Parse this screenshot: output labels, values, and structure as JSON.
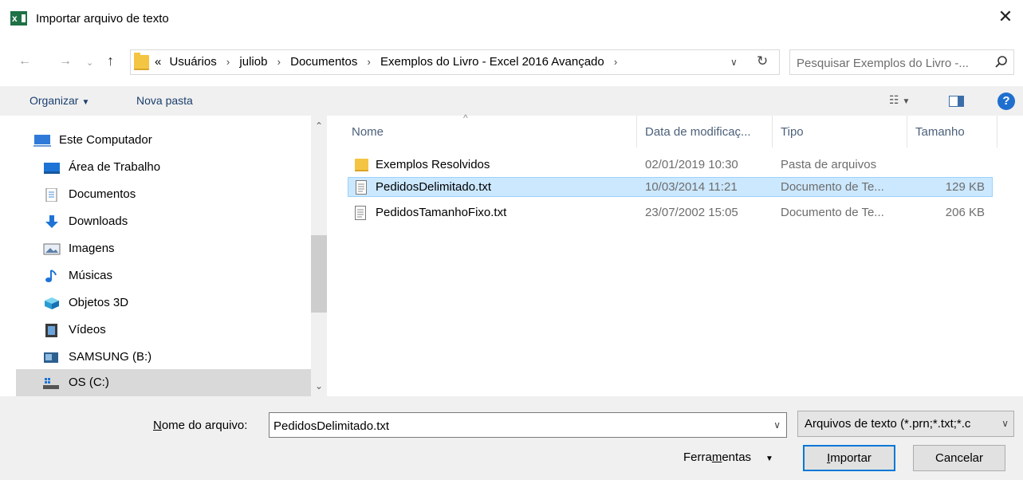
{
  "window": {
    "title": "Importar arquivo de texto",
    "app_icon": "excel-icon",
    "close_label": "✕"
  },
  "address": {
    "overflow": "«",
    "breadcrumbs": [
      "Usuários",
      "juliob",
      "Documentos",
      "Exemplos do Livro - Excel 2016 Avançado"
    ],
    "search_placeholder": "Pesquisar Exemplos do Livro -..."
  },
  "toolbar": {
    "organize_label": "Organizar",
    "new_folder_label": "Nova pasta"
  },
  "sidebar": {
    "items": [
      {
        "label": "Este Computador",
        "icon": "computer-icon"
      },
      {
        "label": "Área de Trabalho",
        "icon": "desktop-icon"
      },
      {
        "label": "Documentos",
        "icon": "documents-icon"
      },
      {
        "label": "Downloads",
        "icon": "downloads-icon"
      },
      {
        "label": "Imagens",
        "icon": "pictures-icon"
      },
      {
        "label": "Músicas",
        "icon": "music-icon"
      },
      {
        "label": "Objetos 3D",
        "icon": "3d-objects-icon"
      },
      {
        "label": "Vídeos",
        "icon": "videos-icon"
      },
      {
        "label": "SAMSUNG (B:)",
        "icon": "drive-icon"
      },
      {
        "label": "OS (C:)",
        "icon": "system-drive-icon",
        "selected": true
      }
    ]
  },
  "filelist": {
    "columns": [
      "Nome",
      "Data de modificaç...",
      "Tipo",
      "Tamanho"
    ],
    "rows": [
      {
        "name": "Exemplos Resolvidos",
        "date": "02/01/2019 10:30",
        "type": "Pasta de arquivos",
        "size": "",
        "icon": "folder-icon",
        "selected": false
      },
      {
        "name": "PedidosDelimitado.txt",
        "date": "10/03/2014 11:21",
        "type": "Documento de Te...",
        "size": "129 KB",
        "icon": "text-file-icon",
        "selected": true
      },
      {
        "name": "PedidosTamanhoFixo.txt",
        "date": "23/07/2002 15:05",
        "type": "Documento de Te...",
        "size": "206 KB",
        "icon": "text-file-icon",
        "selected": false
      }
    ]
  },
  "footer": {
    "filename_label_accel": "N",
    "filename_label_rest": "ome do arquivo:",
    "filename_value": "PedidosDelimitado.txt",
    "filetype_value": "Arquivos de texto (*.prn;*.txt;*.c",
    "tools_pre": "Ferra",
    "tools_accel": "m",
    "tools_post": "entas",
    "import_accel": "I",
    "import_rest": "mportar",
    "cancel_label": "Cancelar"
  }
}
